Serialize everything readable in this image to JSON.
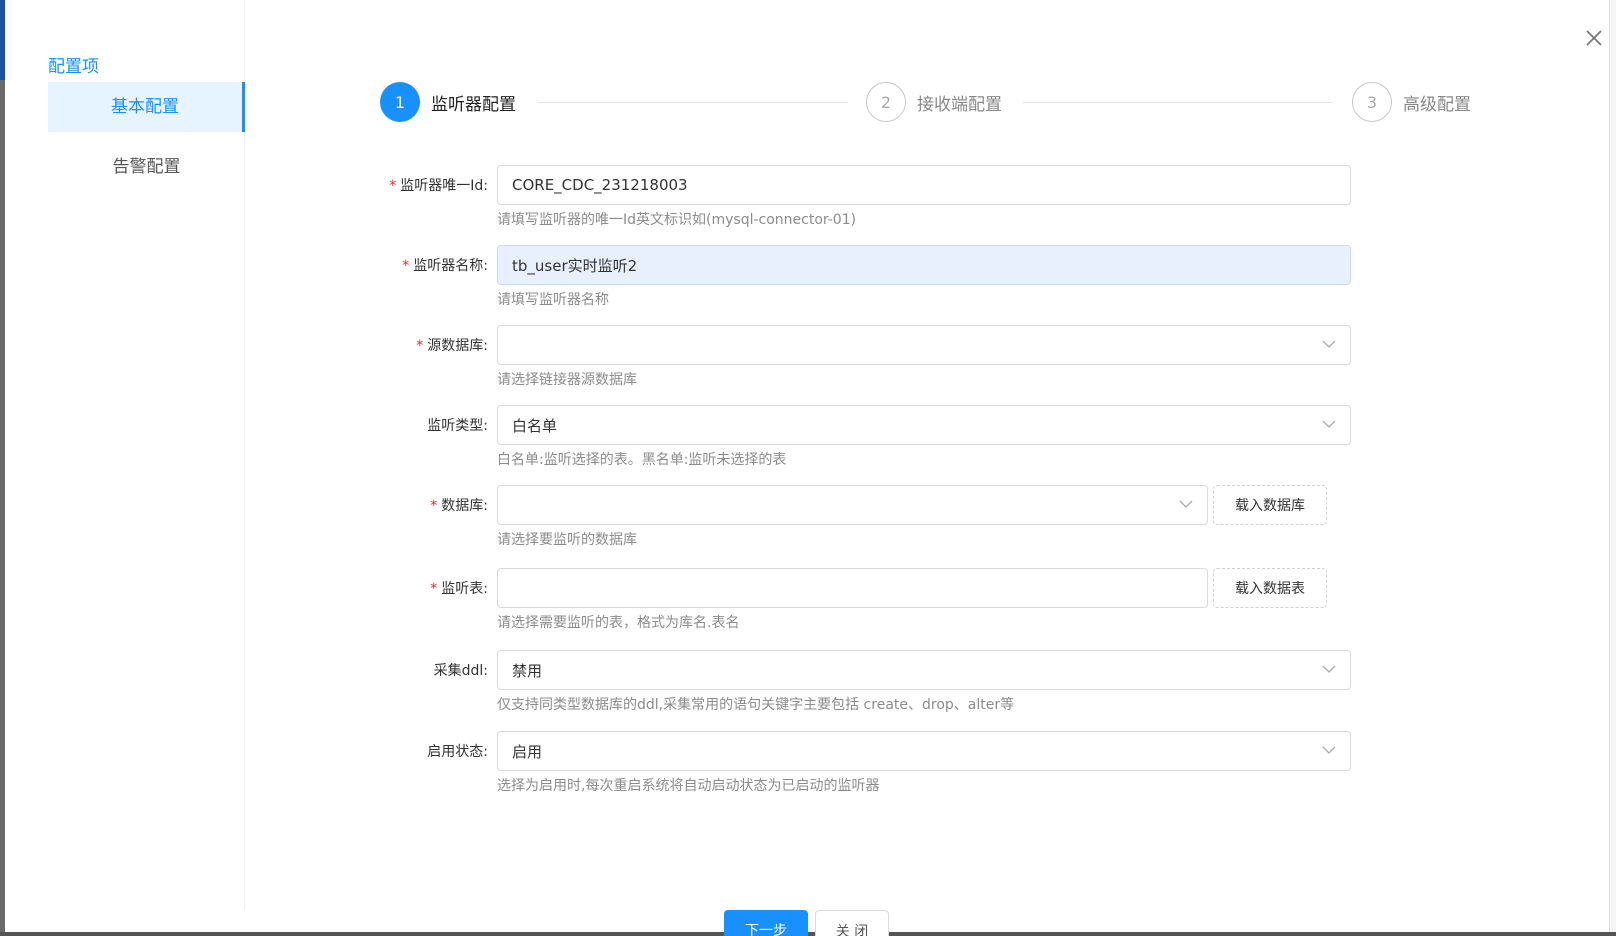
{
  "sidebar": {
    "title": "配置项",
    "items": [
      {
        "label": "基本配置",
        "active": true
      },
      {
        "label": "告警配置",
        "active": false
      }
    ]
  },
  "steps": [
    {
      "number": "1",
      "label": "监听器配置",
      "state": "active"
    },
    {
      "number": "2",
      "label": "接收端配置",
      "state": "pending"
    },
    {
      "number": "3",
      "label": "高级配置",
      "state": "pending"
    }
  ],
  "form": {
    "listener_id": {
      "label": "监听器唯一Id:",
      "required": true,
      "value": "CORE_CDC_231218003",
      "hint": "请填写监听器的唯一Id英文标识如(mysql-connector-01)"
    },
    "listener_name": {
      "label": "监听器名称:",
      "required": true,
      "value": "tb_user实时监听2",
      "hint": "请填写监听器名称"
    },
    "source_db": {
      "label": "源数据库:",
      "required": true,
      "value": "",
      "hint": "请选择链接器源数据库"
    },
    "listen_type": {
      "label": "监听类型:",
      "required": false,
      "value": "白名单",
      "hint": "白名单:监听选择的表。黑名单:监听未选择的表"
    },
    "database": {
      "label": "数据库:",
      "required": true,
      "value": "",
      "hint": "请选择要监听的数据库",
      "button": "载入数据库"
    },
    "listen_table": {
      "label": "监听表:",
      "required": true,
      "value": "",
      "hint": "请选择需要监听的表，格式为库名.表名",
      "button": "载入数据表"
    },
    "collect_ddl": {
      "label": "采集ddl:",
      "required": false,
      "value": "禁用",
      "hint": "仅支持同类型数据库的ddl,采集常用的语句关键字主要包括 create、drop、alter等"
    },
    "enable_status": {
      "label": "启用状态:",
      "required": false,
      "value": "启用",
      "hint": "选择为启用时,每次重启系统将自动启动状态为已启动的监听器"
    }
  },
  "footer": {
    "next_label": "下一步",
    "close_label": "关 闭"
  },
  "colors": {
    "accent": "#1890ff",
    "required": "#f5222d",
    "hint": "#8c8c8c",
    "focused_bg": "#e8f0fe"
  },
  "icons": {
    "close": "close-icon",
    "dropdown": "chevron-down-icon"
  }
}
